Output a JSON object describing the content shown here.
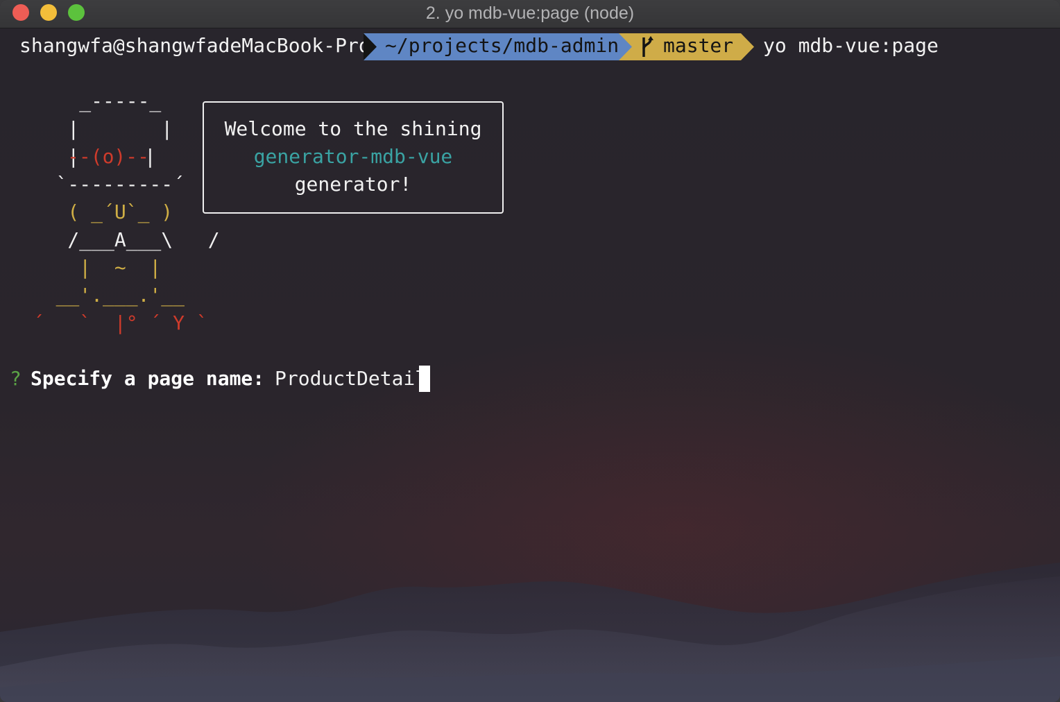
{
  "window": {
    "title": "2. yo mdb-vue:page (node)"
  },
  "prompt": {
    "user_host": "shangwfa@shangwfadeMacBook-Pro",
    "path": "~/projects/mdb-admin",
    "branch_symbol": "",
    "branch": "master",
    "command": "yo mdb-vue:page"
  },
  "yeoman_art": {
    "lines": [
      "     _-----_",
      "    |       |",
      "    |",
      "   `---------´",
      "    ( _´U`_ )",
      "    /___A___\\   /",
      "     |  ~  |",
      "   __'.___.'__",
      " ´   `  |° ´ Y `"
    ],
    "eye": "--(o)--",
    "eye_end": "|"
  },
  "welcome_box": {
    "line1": "Welcome to the shining",
    "line2": "generator-mdb-vue",
    "line3": "generator!"
  },
  "question": {
    "mark": "?",
    "label": "Specify a page name: ",
    "value": "ProductDetail"
  },
  "colors": {
    "path_bg": "#5f86c4",
    "branch_bg": "#cfac48",
    "accent_cyan": "#3aa3a3",
    "question_green": "#5ba346",
    "art_red": "#cf3b2b",
    "art_yellow": "#cfae45"
  }
}
